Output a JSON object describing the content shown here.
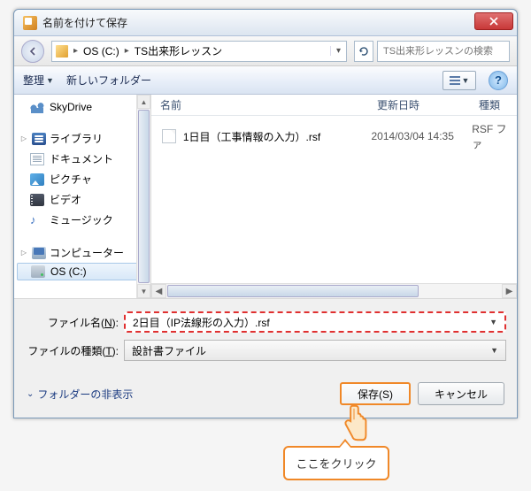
{
  "title": "名前を付けて保存",
  "breadcrumb": {
    "drive": "OS (C:)",
    "folder": "TS出来形レッスン"
  },
  "search_placeholder": "TS出来形レッスンの検索",
  "toolbar": {
    "organize": "整理",
    "new_folder": "新しいフォルダー"
  },
  "columns": {
    "name": "名前",
    "date": "更新日時",
    "type": "種類"
  },
  "sidebar": {
    "skydrive": "SkyDrive",
    "library": "ライブラリ",
    "documents": "ドキュメント",
    "pictures": "ピクチャ",
    "videos": "ビデオ",
    "music": "ミュージック",
    "computer": "コンピューター",
    "os_drive": "OS (C:)"
  },
  "files": [
    {
      "name": "1日目（工事情報の入力）.rsf",
      "date": "2014/03/04 14:35",
      "type": "RSF ファ"
    }
  ],
  "form": {
    "filename_label_pre": "ファイル名(",
    "filename_label_key": "N",
    "filename_label_post": "):",
    "filename_value": "2日目（IP法線形の入力）.rsf",
    "filetype_label_pre": "ファイルの種類(",
    "filetype_label_key": "T",
    "filetype_label_post": "):",
    "filetype_value": "設計書ファイル"
  },
  "footer": {
    "hide_folders": "フォルダーの非表示",
    "save": "保存(S)",
    "cancel": "キャンセル"
  },
  "callout": "ここをクリック"
}
